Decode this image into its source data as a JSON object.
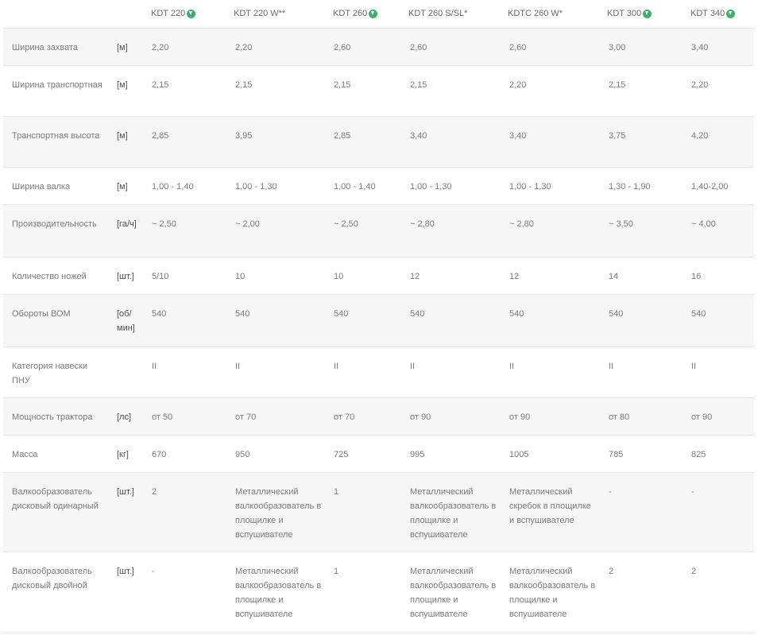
{
  "columns": [
    {
      "name": "KDT 220",
      "badge": true
    },
    {
      "name": "KDT 220 W**",
      "badge": false
    },
    {
      "name": "KDT 260",
      "badge": true
    },
    {
      "name": "KDT 260 S/SL*",
      "badge": false
    },
    {
      "name": "KDTC 260 W*",
      "badge": false
    },
    {
      "name": "KDT 300",
      "badge": true
    },
    {
      "name": "KDT 340",
      "badge": true
    }
  ],
  "rows": [
    {
      "label": "Ширина захвата",
      "unit": "[м]",
      "values": [
        "2,20",
        "2,20",
        "2,60",
        "2,60",
        "2,60",
        "3,00",
        "3,40"
      ]
    },
    {
      "label": "Ширина транспортная",
      "unit": "[м]",
      "values": [
        "2,15",
        "2,15",
        "2,15",
        "2,15",
        "2,20",
        "2,15",
        "2,20"
      ]
    },
    {
      "label": "Транспортная высота",
      "unit": "[м]",
      "values": [
        "2,85",
        "3,95",
        "2,85",
        "3,40",
        "3,40",
        "3,75",
        "4,20"
      ]
    },
    {
      "label": "Ширина валка",
      "unit": "[м]",
      "values": [
        "1,00 - 1,40",
        "1,00 - 1,30",
        "1,00 - 1,40",
        "1,00 - 1,30",
        "1,00 - 1,30",
        "1,30 - 1,90",
        "1,40-2,00"
      ]
    },
    {
      "label": "Производительность",
      "unit": "[га/ч]",
      "values": [
        "~ 2,50",
        "~ 2,00",
        "~ 2,50",
        "~ 2,80",
        "~ 2,80",
        "~ 3,50",
        "~ 4,00"
      ]
    },
    {
      "label": "Количество ножей",
      "unit": "[шт.]",
      "values": [
        "5/10",
        "10",
        "10",
        "12",
        "12",
        "14",
        "16"
      ]
    },
    {
      "label": "Обороты ВОМ",
      "unit": "[об/мин]",
      "values": [
        "540",
        "540",
        "540",
        "540",
        "540",
        "540",
        "540"
      ]
    },
    {
      "label": "Категория навески ПНУ",
      "unit": "",
      "values": [
        "II",
        "II",
        "II",
        "II",
        "II",
        "II",
        "II"
      ]
    },
    {
      "label": "Мощность трактора",
      "unit": "[лс]",
      "values": [
        "от 50",
        "от 70",
        "от 70",
        "от 90",
        "от 90",
        "от 80",
        "от 90"
      ]
    },
    {
      "label": "Масса",
      "unit": "[кг]",
      "values": [
        "670",
        "950",
        "725",
        "995",
        "1005",
        "785",
        "825"
      ]
    },
    {
      "label": "Валкообразователь дисковый одинарный",
      "unit": "[шт.]",
      "values": [
        "2",
        "Металлический валкообразователь в площилке и вспушивателе",
        "1",
        "Металлический валкообразователь в площилке и вспушивателе",
        "Металлический скребок в площилке и вспушивателе",
        "-",
        "-"
      ]
    },
    {
      "label": "Валкообразователь дисковый двойной",
      "unit": "[шт.]",
      "values": [
        "-",
        "Металлический валкообразователь в площилке и вспушивателе",
        "1",
        "Металлический валкообразователь в площилке и вспушивателе",
        "Металлический валкообразователь в площилке и вспушивателе",
        "2",
        "2"
      ]
    }
  ]
}
